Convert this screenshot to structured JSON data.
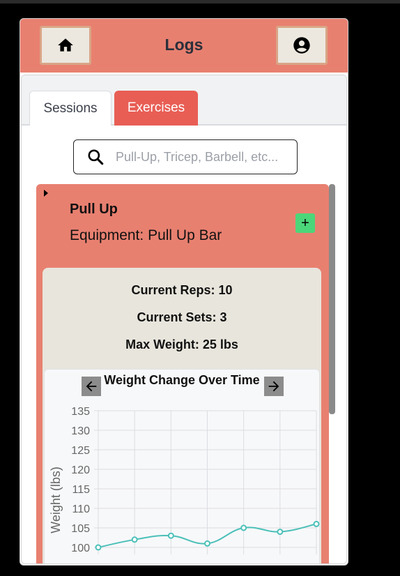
{
  "header": {
    "title": "Logs",
    "home_icon": "home-icon",
    "profile_icon": "account-circle-icon"
  },
  "tabs": [
    {
      "label": "Sessions",
      "active": false
    },
    {
      "label": "Exercises",
      "active": true
    }
  ],
  "search": {
    "placeholder": "Pull-Up, Tricep, Barbell, etc...",
    "value": ""
  },
  "exercise": {
    "name": "Pull Up",
    "equipment_label": "Equipment:",
    "equipment": "Pull Up Bar",
    "add_label": "+",
    "stats": [
      {
        "label": "Current Reps:",
        "value": "10"
      },
      {
        "label": "Current Sets:",
        "value": "3"
      },
      {
        "label": "Max Weight:",
        "value": "25 lbs"
      }
    ]
  },
  "colors": {
    "header": "#e88070",
    "active_tab": "#e85e55",
    "add_button": "#4cd67a",
    "line": "#4bc0b8"
  },
  "chart_data": {
    "type": "line",
    "title": "Weight Change Over Time",
    "ylabel": "Weight (lbs)",
    "xlabel": "",
    "ylim": [
      100,
      135
    ],
    "yticks": [
      100,
      105,
      110,
      115,
      120,
      125,
      130,
      135
    ],
    "x": [
      1,
      2,
      3,
      4,
      5,
      6,
      7
    ],
    "series": [
      {
        "values": [
          100,
          102,
          103,
          101,
          105,
          104,
          106
        ]
      }
    ],
    "grid": true
  }
}
